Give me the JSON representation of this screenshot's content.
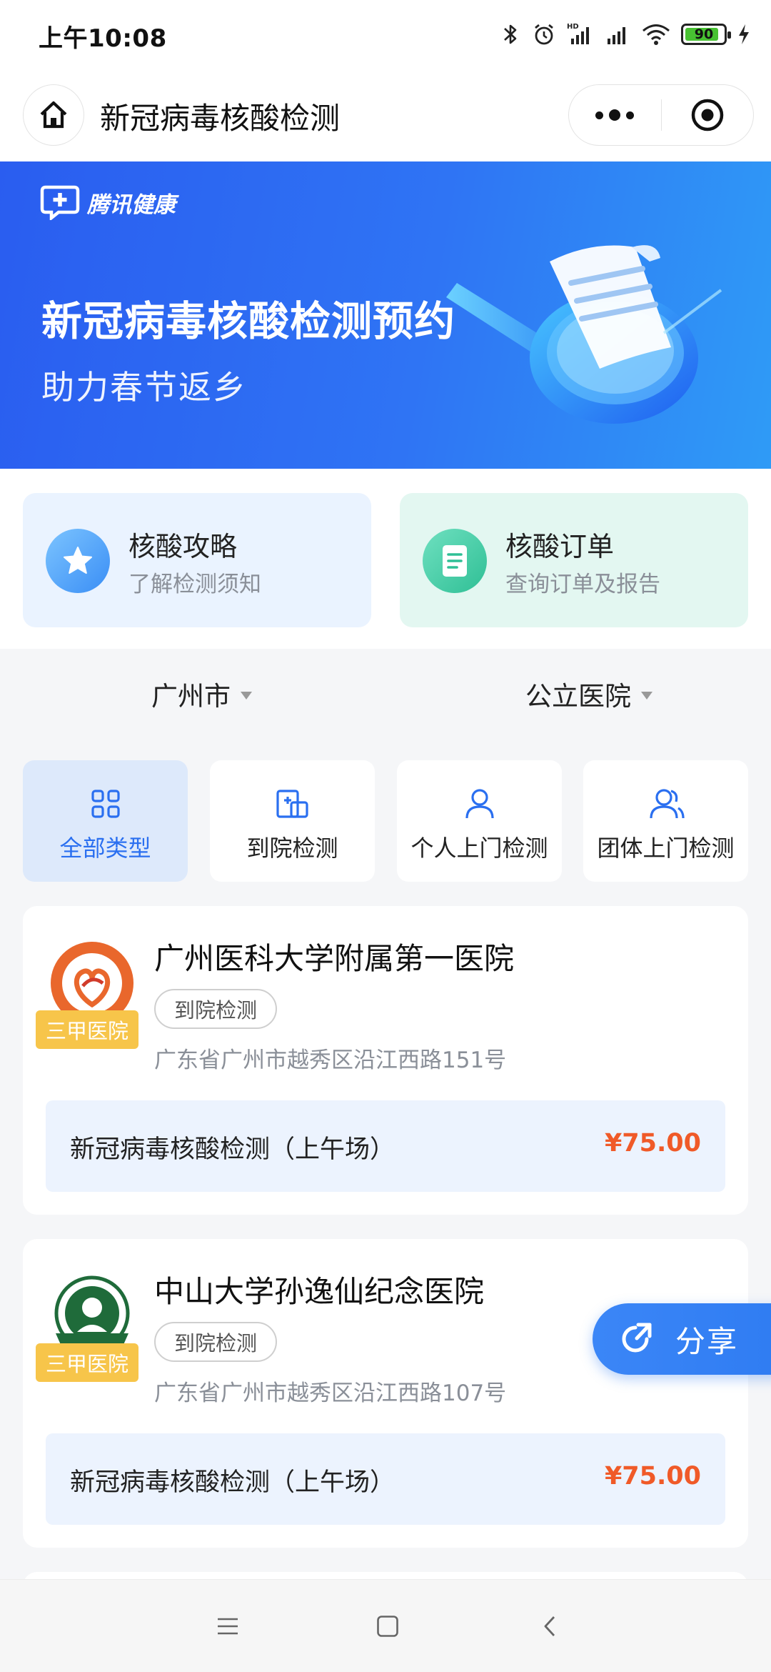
{
  "status_bar": {
    "time": "上午10:08",
    "battery": "90"
  },
  "header": {
    "title": "新冠病毒核酸检测"
  },
  "banner": {
    "brand": "腾讯健康",
    "title": "新冠病毒核酸检测预约",
    "subtitle": "助力春节返乡"
  },
  "quick_cards": [
    {
      "title": "核酸攻略",
      "subtitle": "了解检测须知",
      "icon": "star-icon"
    },
    {
      "title": "核酸订单",
      "subtitle": "查询订单及报告",
      "icon": "document-icon"
    }
  ],
  "filters": {
    "city": "广州市",
    "hospital_type": "公立医院"
  },
  "tabs": [
    {
      "label": "全部类型",
      "icon": "grid-icon",
      "active": true
    },
    {
      "label": "到院检测",
      "icon": "hospital-icon",
      "active": false
    },
    {
      "label": "个人上门检测",
      "icon": "person-icon",
      "active": false
    },
    {
      "label": "团体上门检测",
      "icon": "group-icon",
      "active": false
    }
  ],
  "hospitals": [
    {
      "name": "广州医科大学附属第一医院",
      "grade": "三甲医院",
      "tag": "到院检测",
      "address": "广东省广州市越秀区沿江西路151号",
      "service": {
        "name": "新冠病毒核酸检测（上午场）",
        "price": "¥75.00"
      }
    },
    {
      "name": "中山大学孙逸仙纪念医院",
      "grade": "三甲医院",
      "tag": "到院检测",
      "address": "广东省广州市越秀区沿江西路107号",
      "service": {
        "name": "新冠病毒核酸检测（上午场）",
        "price": "¥75.00"
      }
    }
  ],
  "share": {
    "label": "分享"
  },
  "colors": {
    "accent": "#2a6ff0",
    "price": "#f05a28",
    "grade": "#f7c54a"
  }
}
